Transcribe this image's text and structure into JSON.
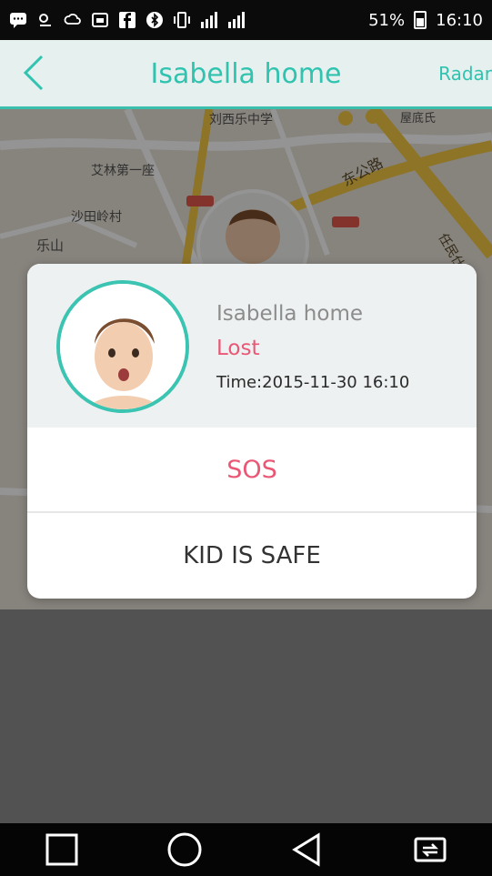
{
  "statusbar": {
    "battery": "51%",
    "time": "16:10"
  },
  "header": {
    "title": "Isabella home",
    "radar_label": "Radar"
  },
  "map": {
    "labels": [
      "刘西乐中学",
      "艾林第一座",
      "沙田岭村",
      "乐山",
      "东公路",
      "屋底氏",
      "任民仕"
    ]
  },
  "dialog": {
    "name": "Isabella home",
    "status": "Lost",
    "time": "Time:2015-11-30 16:10",
    "sos_label": "SOS",
    "safe_label": "KID IS SAFE"
  },
  "colors": {
    "accent": "#3bc4b1",
    "alert": "#ea5775"
  },
  "icons": {
    "back": "chevron-left-icon",
    "nav_recent": "square-icon",
    "nav_home": "circle-icon",
    "nav_back": "triangle-back-icon",
    "nav_switch": "switch-icon"
  }
}
